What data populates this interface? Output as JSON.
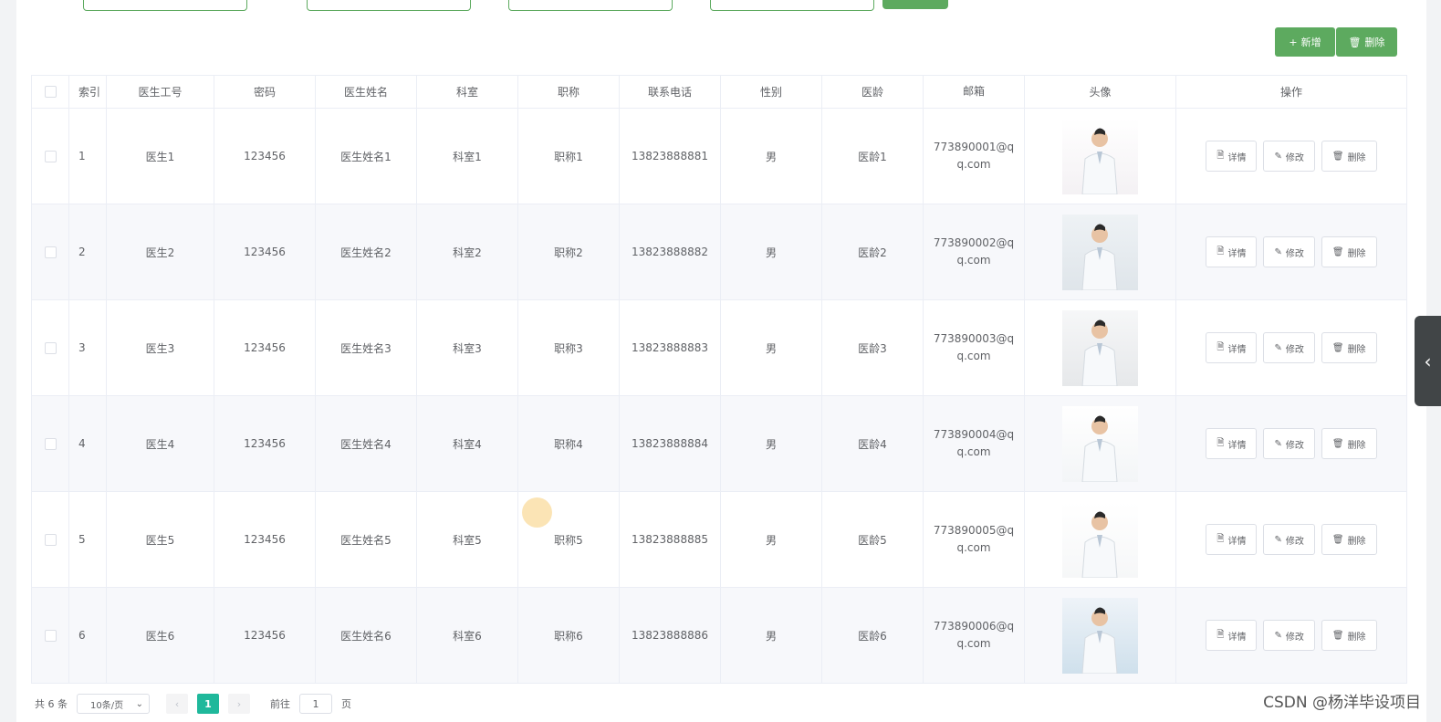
{
  "toolbar": {
    "add_label": "新增",
    "delete_label": "删除",
    "add_icon": "plus-icon",
    "delete_icon": "trash-icon"
  },
  "table": {
    "headers": [
      "索引",
      "医生工号",
      "密码",
      "医生姓名",
      "科室",
      "职称",
      "联系电话",
      "性别",
      "医龄",
      "邮箱",
      "头像",
      "操作"
    ],
    "rows": [
      {
        "index": "1",
        "no": "医生1",
        "password": "123456",
        "name": "医生姓名1",
        "dept": "科室1",
        "title": "职称1",
        "phone": "13823888881",
        "sex": "男",
        "age": "医龄1",
        "email": "773890001@qq.com"
      },
      {
        "index": "2",
        "no": "医生2",
        "password": "123456",
        "name": "医生姓名2",
        "dept": "科室2",
        "title": "职称2",
        "phone": "13823888882",
        "sex": "男",
        "age": "医龄2",
        "email": "773890002@qq.com"
      },
      {
        "index": "3",
        "no": "医生3",
        "password": "123456",
        "name": "医生姓名3",
        "dept": "科室3",
        "title": "职称3",
        "phone": "13823888883",
        "sex": "男",
        "age": "医龄3",
        "email": "773890003@qq.com"
      },
      {
        "index": "4",
        "no": "医生4",
        "password": "123456",
        "name": "医生姓名4",
        "dept": "科室4",
        "title": "职称4",
        "phone": "13823888884",
        "sex": "男",
        "age": "医龄4",
        "email": "773890004@qq.com"
      },
      {
        "index": "5",
        "no": "医生5",
        "password": "123456",
        "name": "医生姓名5",
        "dept": "科室5",
        "title": "职称5",
        "phone": "13823888885",
        "sex": "男",
        "age": "医龄5",
        "email": "773890005@qq.com"
      },
      {
        "index": "6",
        "no": "医生6",
        "password": "123456",
        "name": "医生姓名6",
        "dept": "科室6",
        "title": "职称6",
        "phone": "13823888886",
        "sex": "男",
        "age": "医龄6",
        "email": "773890006@qq.com"
      }
    ],
    "ops": {
      "detail": "详情",
      "edit": "修改",
      "delete": "删除"
    }
  },
  "pagination": {
    "total_text": "共 6 条",
    "page_size": "10条/页",
    "current_page": "1",
    "goto_label": "前往",
    "goto_value": "1",
    "page_unit": "页"
  },
  "watermark": "CSDN @杨洋毕设项目",
  "colors": {
    "accent": "#5daa5f",
    "pager_active": "#1fb89b"
  }
}
